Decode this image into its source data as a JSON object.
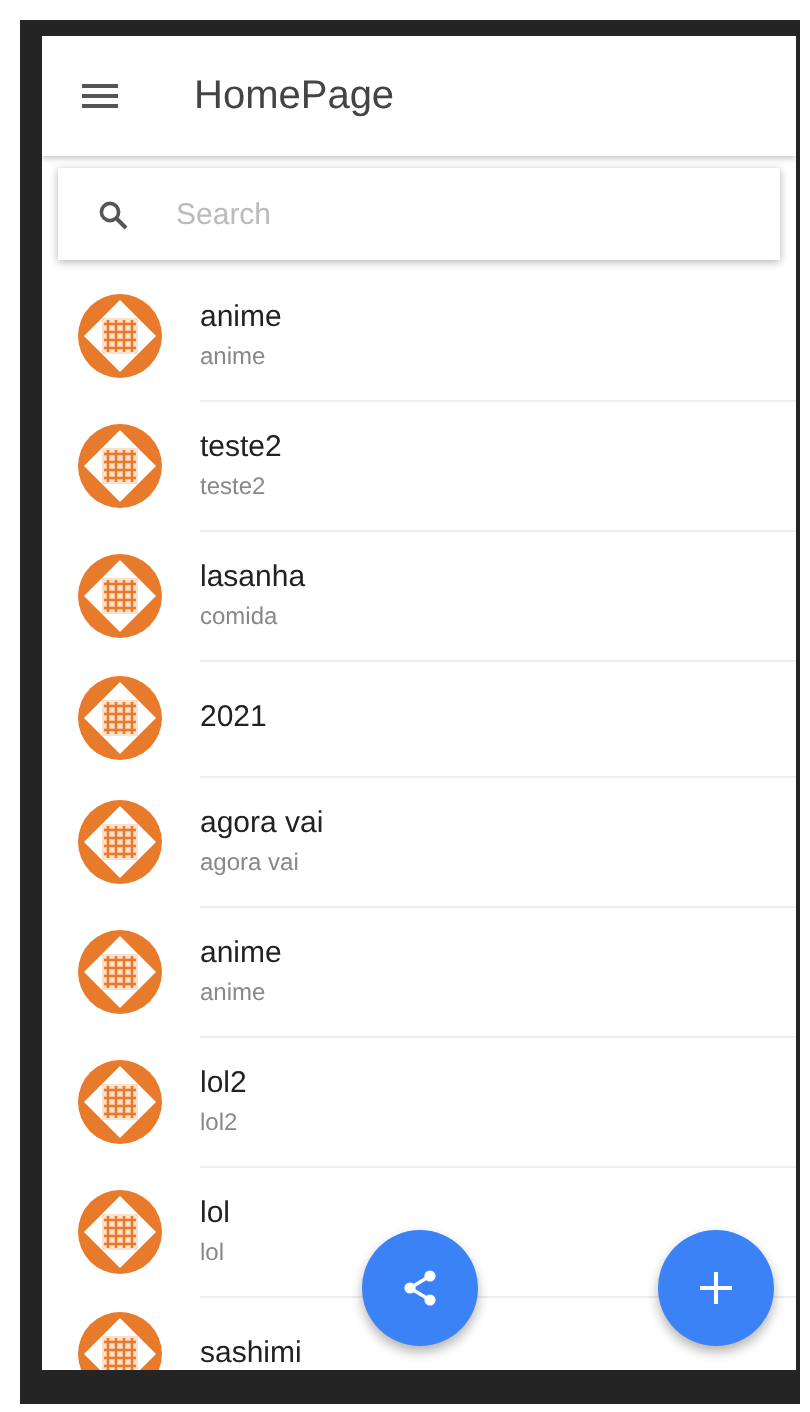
{
  "app_bar": {
    "title": "HomePage"
  },
  "search": {
    "placeholder": "Search"
  },
  "items": [
    {
      "title": "anime",
      "subtitle": "anime"
    },
    {
      "title": "teste2",
      "subtitle": "teste2"
    },
    {
      "title": "lasanha",
      "subtitle": "comida"
    },
    {
      "title": "2021"
    },
    {
      "title": "agora vai",
      "subtitle": "agora vai"
    },
    {
      "title": "anime",
      "subtitle": "anime"
    },
    {
      "title": "lol2",
      "subtitle": "lol2"
    },
    {
      "title": "lol",
      "subtitle": "lol"
    },
    {
      "title": "sashimi"
    }
  ],
  "fabs": [
    {
      "kind": "share"
    },
    {
      "kind": "add"
    }
  ]
}
